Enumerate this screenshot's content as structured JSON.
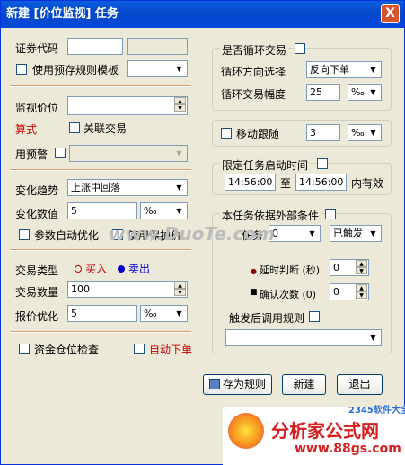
{
  "window": {
    "title": "新建 [价位监视] 任务",
    "close": "X"
  },
  "left": {
    "code_label": "证券代码",
    "code_value": "",
    "code_name": "",
    "template_label": "使用预存规则模板",
    "template_value": "",
    "price_label": "监视价位",
    "price_value": "",
    "formula_label": "算式",
    "link_trade_label": "关联交易",
    "preset_label": "用预警",
    "preset_value": "",
    "trend_label": "变化趋势",
    "trend_value": "上涨中回落",
    "change_label": "变化数值",
    "change_value": "5",
    "change_unit": "‰",
    "auto_opt_label": "参数自动优化",
    "protect_price_label": "使用保护价",
    "trade_type_label": "交易类型",
    "buy_label": "买入",
    "sell_label": "卖出",
    "qty_label": "交易数量",
    "qty_value": "100",
    "quote_label": "报价优化",
    "quote_value": "5",
    "quote_unit": "‰",
    "fund_check_label": "资金仓位检查",
    "auto_order_label": "自动下单"
  },
  "right": {
    "loop_label": "是否循环交易",
    "loop_dir_label": "循环方向选择",
    "loop_dir_value": "反向下单",
    "loop_range_label": "循环交易幅度",
    "loop_range_value": "25",
    "loop_range_unit": "‰",
    "trail_label": "移动跟随",
    "trail_value": "3",
    "trail_unit": "‰",
    "time_label": "限定任务启动时间",
    "time_start": "14:56:00",
    "time_to": "至",
    "time_end": "14:56:00",
    "time_valid": "内有效",
    "ext_label": "本任务依据外部条件",
    "task_label": "任务",
    "task_value": "0",
    "trigger_value": "已触发",
    "delay_label": "延时判断 (秒)",
    "delay_value": "0",
    "confirm_label": "确认次数 (0)",
    "confirm_value": "0",
    "after_label": "触发后调用规则",
    "after_value": ""
  },
  "buttons": {
    "save": "存为规则",
    "new": "新建",
    "exit": "退出"
  },
  "watermark": {
    "text": "www.DuoTe.com",
    "logo1": "分析家公式网",
    "logo2": "www.88gs.com",
    "badge": "2345软件大全"
  }
}
